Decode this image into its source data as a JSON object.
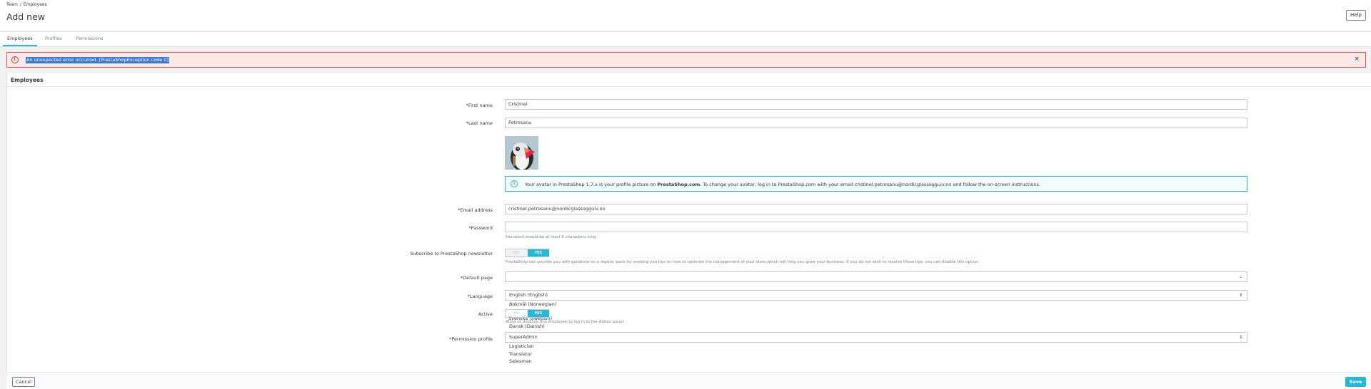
{
  "header": {
    "breadcrumb": [
      "Team",
      "Employees"
    ],
    "breadcrumb_sep": "/",
    "title": "Add new",
    "help_label": "Help"
  },
  "tabs": [
    {
      "label": "Employees",
      "active": true
    },
    {
      "label": "Profiles",
      "active": false
    },
    {
      "label": "Permissions",
      "active": false
    }
  ],
  "alert": {
    "message": "An unexpected error occurred. [PrestaShopException code 0]",
    "close": "×"
  },
  "panel": {
    "title": "Employees",
    "first_name": {
      "label": "*First name",
      "value": "Cristinel"
    },
    "last_name": {
      "label": "*Last name",
      "value": "Petrosanu"
    },
    "avatar_info": {
      "text_before": "Your avatar in PrestaShop 1.7.x is your profile picture on ",
      "brand": "PrestaShop.com",
      "text_after": ". To change your avatar, log in to PrestaShop.com with your email cristinel.petrosanu@nordicglassogguiv.no and follow the on-screen instructions."
    },
    "email": {
      "label": "*Email address",
      "value": "cristinel.petrosanu@nordicglassogguiv.no"
    },
    "password": {
      "label": "*Password",
      "value": "",
      "help": "Password should be at least 8 characters long."
    },
    "newsletter": {
      "label": "Subscribe to PrestaShop newsletter",
      "no": "NO",
      "yes": "YES",
      "help": "PrestaShop can provide you with guidance on a regular basis by sending you tips on how to optimize the management of your store which will help you grow your business. If you do not wish to receive these tips, you can disable this option."
    },
    "default_page": {
      "label": "*Default page",
      "value": ""
    },
    "language": {
      "label": "*Language",
      "value": "English (English)",
      "options_visible": [
        "Bokmål (Norwegian)",
        "Svenska (Swedish)",
        "Dansk (Danish)"
      ]
    },
    "active": {
      "label": "Active",
      "no": "NO",
      "yes": "YES",
      "help": "Allow or disallow this employee to log in to the Admin panel."
    },
    "permission_profile": {
      "label": "*Permission profile",
      "value": "SuperAdmin",
      "options_visible": [
        "Logistician",
        "Translator",
        "Salesman"
      ]
    }
  },
  "footer": {
    "cancel_label": "Cancel",
    "save_label": "Save"
  },
  "colors": {
    "accent": "#25b9d7",
    "error": "#f54c3e",
    "selection": "#3b79d4"
  }
}
